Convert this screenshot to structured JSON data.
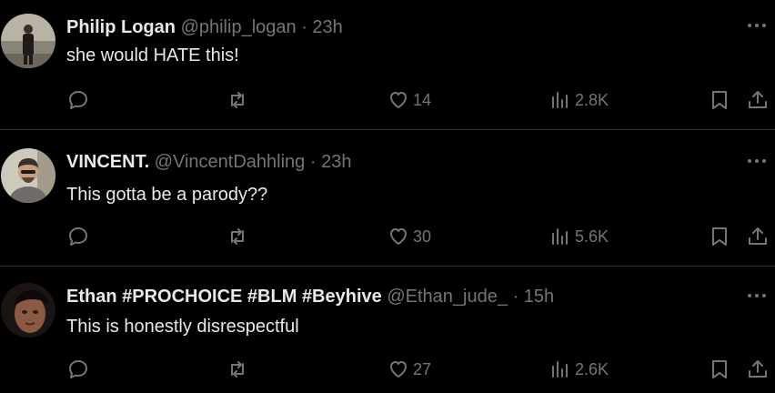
{
  "tweets": [
    {
      "name": "Philip Logan",
      "handle": "@philip_logan",
      "separator": "·",
      "time": "23h",
      "text": "she would HATE this!",
      "likes": "14",
      "views": "2.8K"
    },
    {
      "name": "VINCENT.",
      "handle": "@VincentDahhling",
      "separator": "·",
      "time": "23h",
      "text": "This gotta be a parody??",
      "likes": "30",
      "views": "5.6K"
    },
    {
      "name": "Ethan #PROCHOICE #BLM #Beyhive",
      "handle": "@Ethan_jude_",
      "separator": "·",
      "time": "15h",
      "text": "This is honestly disrespectful",
      "likes": "27",
      "views": "2.6K"
    }
  ],
  "colors": {
    "background": "#000000",
    "text": "#e7e9ea",
    "muted": "#71767b",
    "divider": "#2f3336"
  },
  "icons": [
    "more-icon",
    "reply-icon",
    "retweet-icon",
    "like-icon",
    "views-icon",
    "bookmark-icon",
    "share-icon"
  ]
}
